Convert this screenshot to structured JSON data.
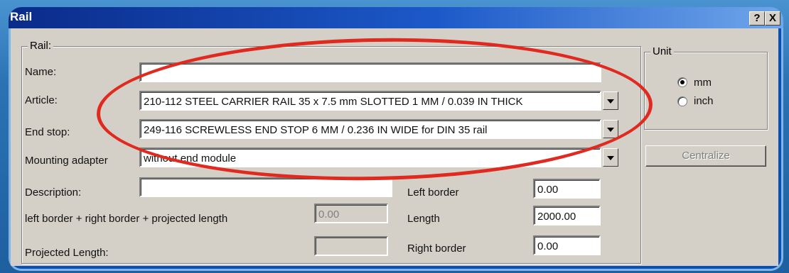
{
  "window": {
    "title": "Rail",
    "help_label": "?",
    "close_label": "X"
  },
  "rail_group": {
    "title": "Rail:",
    "name_label": "Name:",
    "name_value": "",
    "article_label": "Article:",
    "article_value": "210-112 STEEL CARRIER RAIL 35 x 7.5 mm SLOTTED 1 MM / 0.039 IN THICK",
    "end_stop_label": "End stop:",
    "end_stop_value": "249-116 SCREWLESS END STOP 6 MM / 0.236 IN WIDE for DIN 35 rail",
    "mounting_label": "Mounting adapter",
    "mounting_value": "without end module",
    "description_label": "Description:",
    "description_value": "",
    "sum_label": "left border + right border + projected length",
    "sum_value": "0.00",
    "projected_label": "Projected Length:",
    "projected_value": "",
    "left_border_label": "Left border",
    "left_border_value": "0.00",
    "length_label": "Length",
    "length_value": "2000.00",
    "right_border_label": "Right border",
    "right_border_value": "0.00"
  },
  "unit_group": {
    "title": "Unit",
    "mm_label": "mm",
    "inch_label": "inch",
    "selected": "mm"
  },
  "centralize_label": "Centralize",
  "colors": {
    "highlight_ring": "#e02a20",
    "dialog_bg": "#d4d0c8",
    "titlebar": "#0a2b8a"
  }
}
